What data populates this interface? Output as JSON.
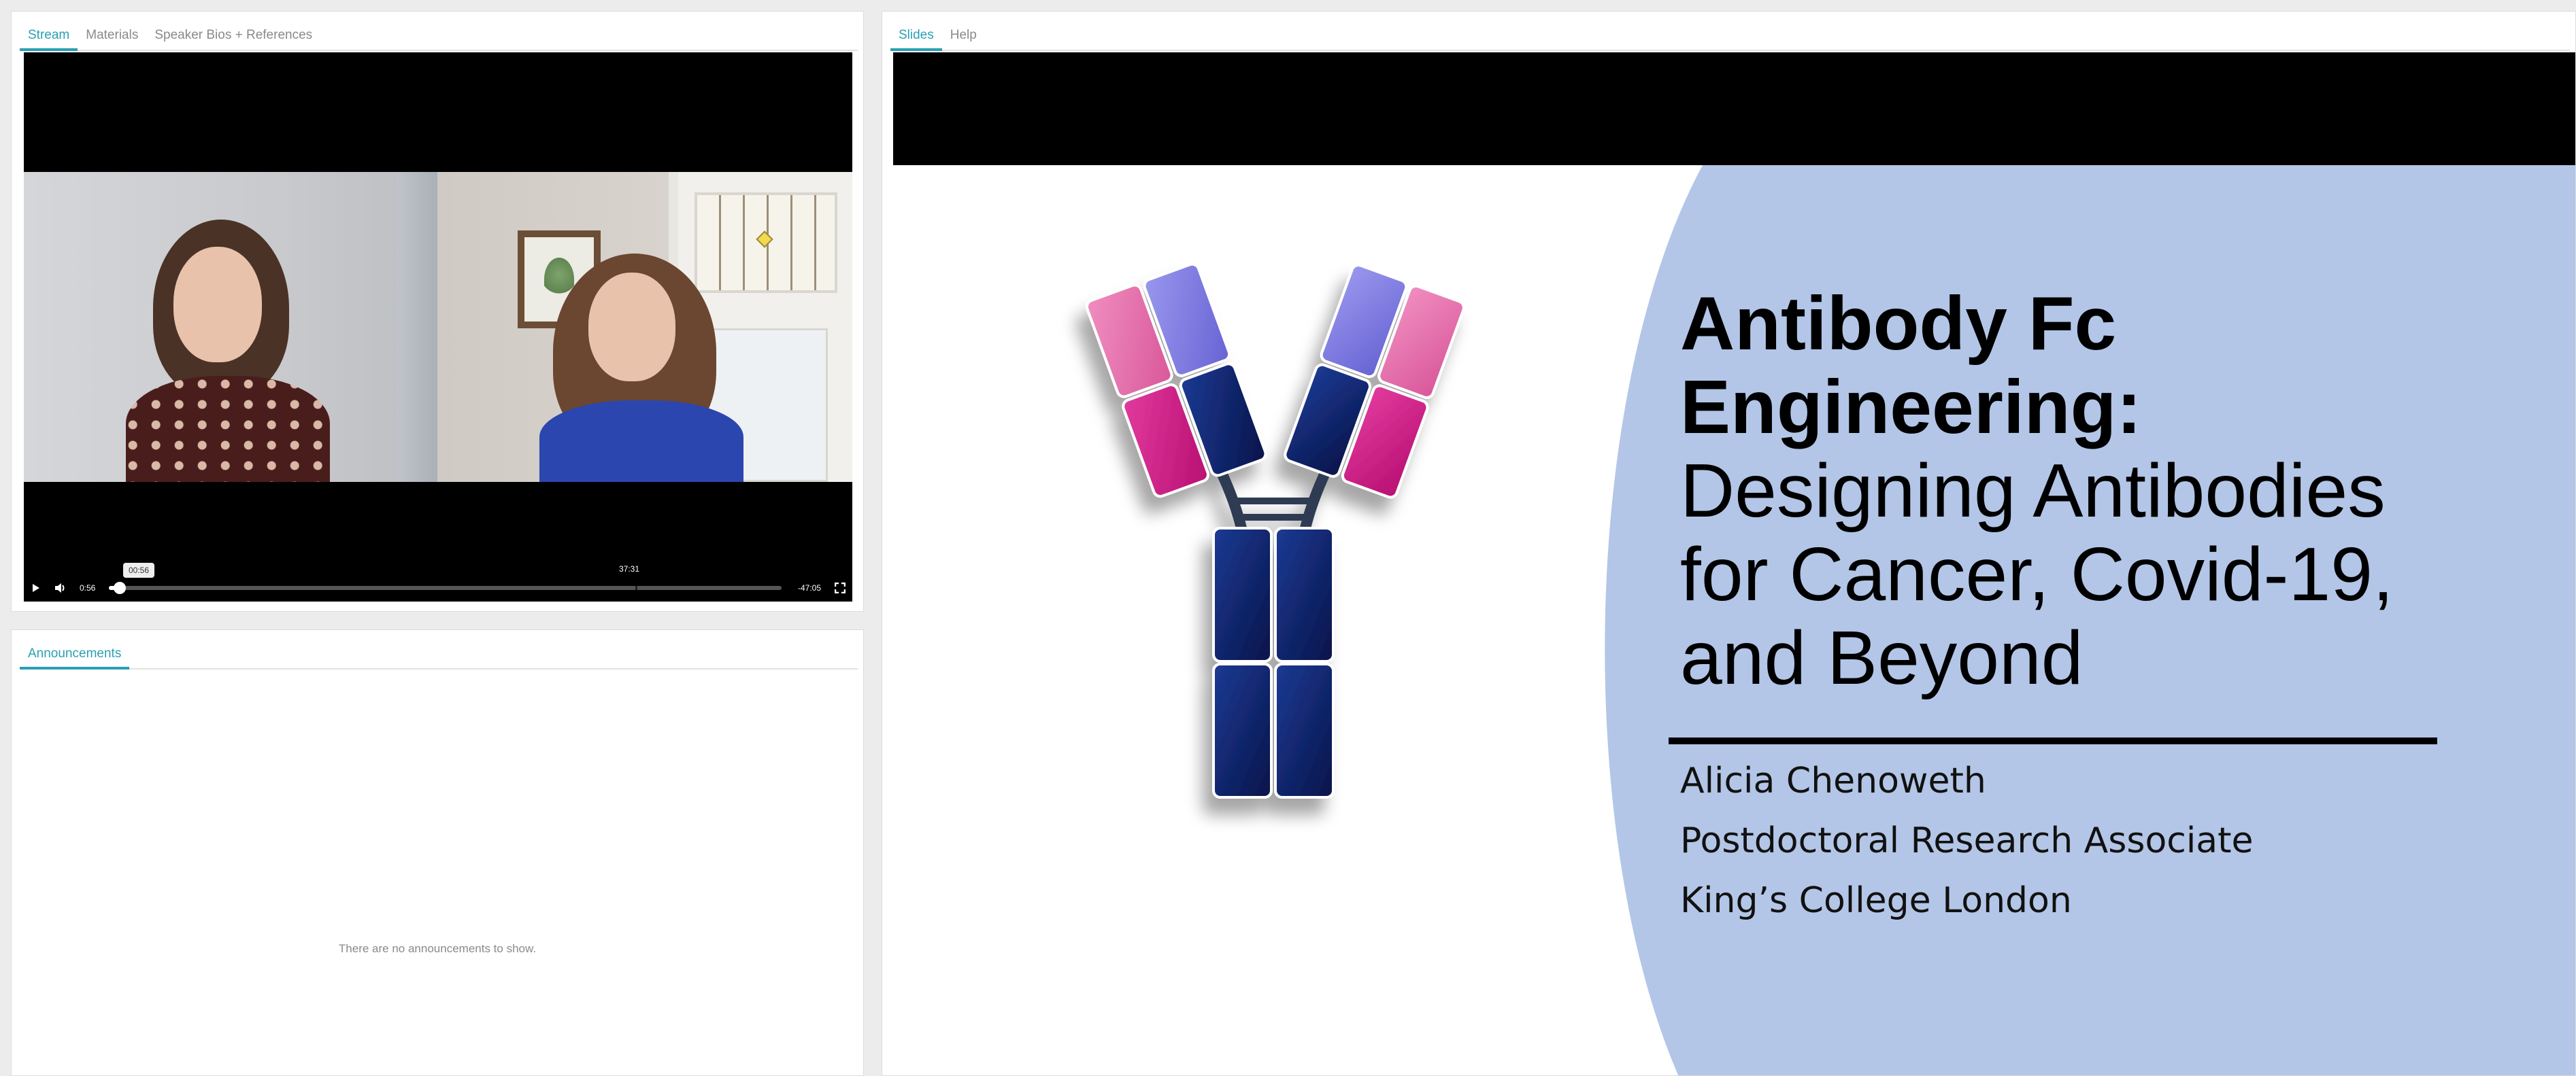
{
  "stream_panel": {
    "tabs": [
      {
        "label": "Stream",
        "active": true
      },
      {
        "label": "Materials",
        "active": false
      },
      {
        "label": "Speaker Bios + References",
        "active": false
      }
    ],
    "video": {
      "hover_time": "00:56",
      "chapter_time": "37:31",
      "elapsed": "0:56",
      "remaining": "-47:05",
      "progress_fraction": 0.016,
      "chapter_fraction": 0.783
    },
    "icons": {
      "play": "play-icon",
      "volume": "volume-icon",
      "fullscreen": "fullscreen-icon"
    }
  },
  "announcements_panel": {
    "tabs": [
      {
        "label": "Announcements",
        "active": true
      }
    ],
    "empty_message": "There are no announcements to show."
  },
  "slides_panel": {
    "tabs": [
      {
        "label": "Slides",
        "active": true
      },
      {
        "label": "Help",
        "active": false
      }
    ],
    "slide": {
      "title_bold_line1": "Antibody Fc",
      "title_bold_line2": "Engineering:",
      "title_line3": "Designing Antibodies",
      "title_line4": "for Cancer, Covid-19,",
      "title_line5": "and Beyond",
      "speaker_name": "Alicia Chenoweth",
      "speaker_role": "Postdoctoral Research Associate",
      "speaker_affiliation": "King’s College London"
    }
  },
  "colors": {
    "accent": "#2a9fb3",
    "slide_blue": "#b3c6e7",
    "antibody_navy": "#0c1f66",
    "antibody_magenta": "#d4178a",
    "antibody_pink": "#e56aa6",
    "antibody_lavender": "#7f7be0"
  }
}
